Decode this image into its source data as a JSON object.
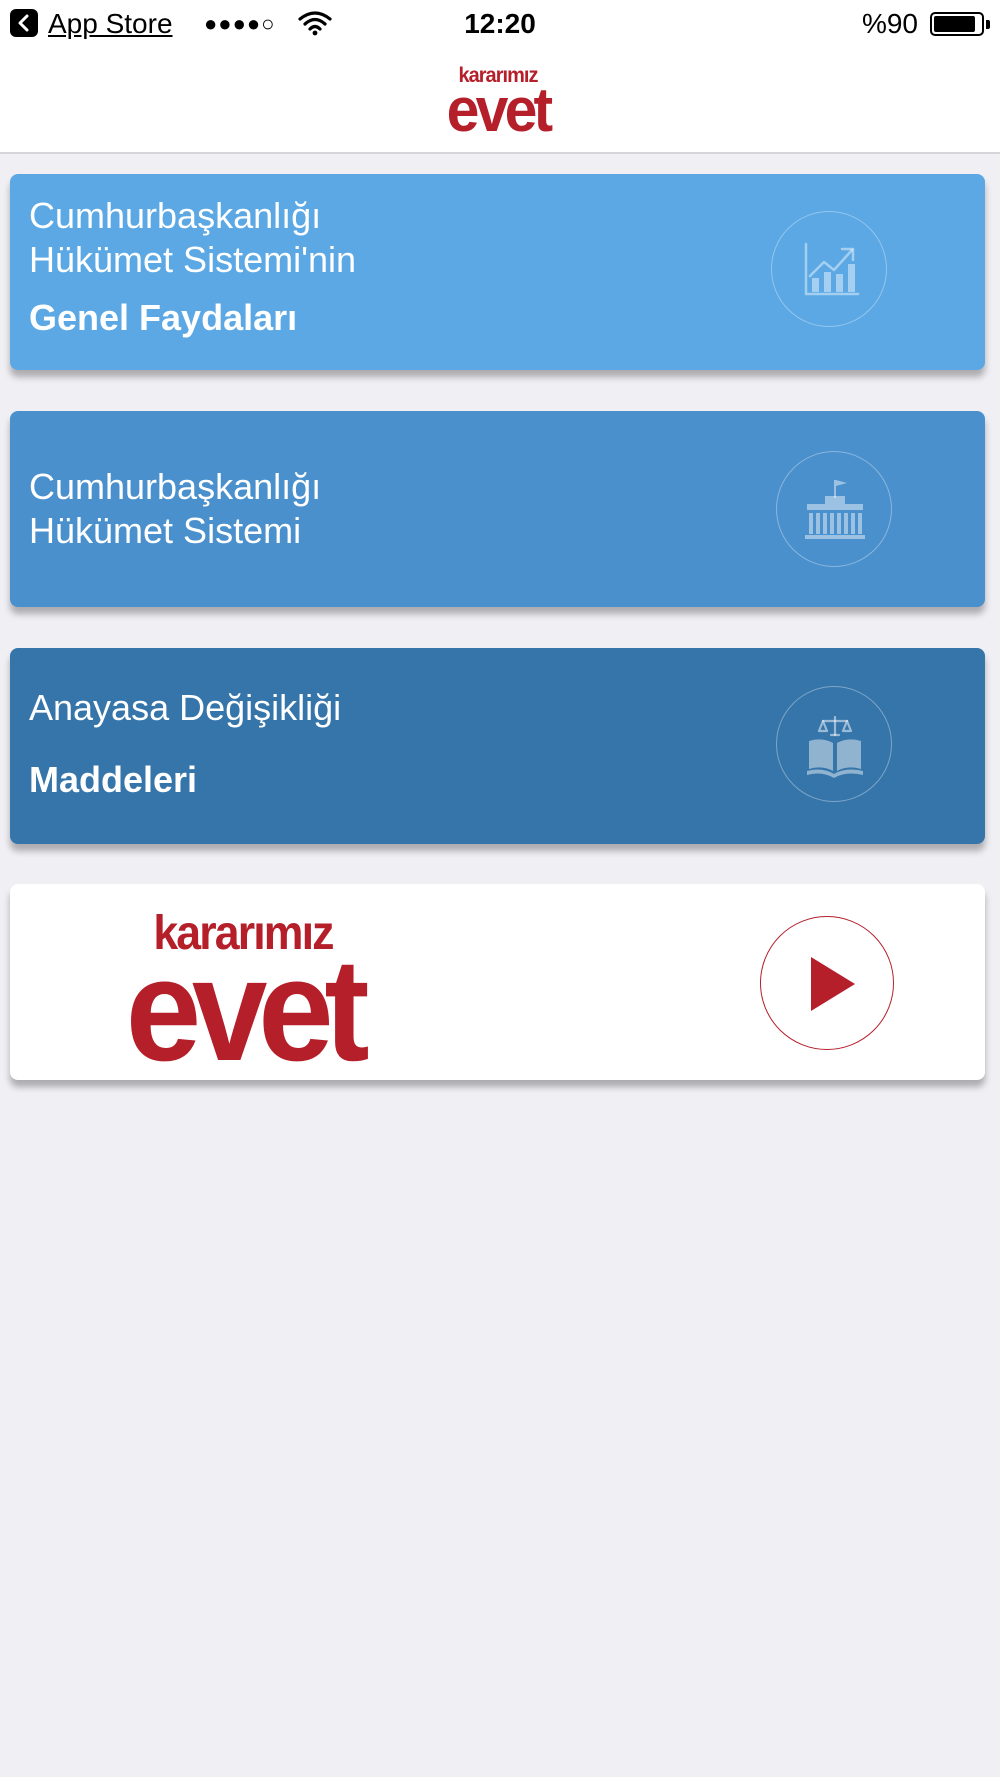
{
  "status_bar": {
    "back_app": "App Store",
    "signal": "●●●●○",
    "time": "12:20",
    "battery": "%90",
    "battery_level": 0.9
  },
  "nav": {
    "logo_top": "kararımız",
    "logo_main": "evet"
  },
  "cards": [
    {
      "lines": [
        "Cumhurbaşkanlığı",
        "Hükümet Sistemi'nin"
      ],
      "bold": "Genel Faydaları",
      "icon": "growth-chart-icon",
      "color": "#5ba8e4"
    },
    {
      "lines": [
        "Cumhurbaşkanlığı",
        "Hükümet Sistemi"
      ],
      "icon": "government-building-icon",
      "color": "#4a90cc"
    },
    {
      "lines": [
        "Anayasa Değişikliği"
      ],
      "bold": "Maddeleri",
      "icon": "law-book-scales-icon",
      "color": "#3675aa"
    }
  ],
  "promo": {
    "logo_top": "kararımız",
    "logo_main": "evet",
    "play_icon": "play-icon",
    "accent": "#b51f2a"
  }
}
